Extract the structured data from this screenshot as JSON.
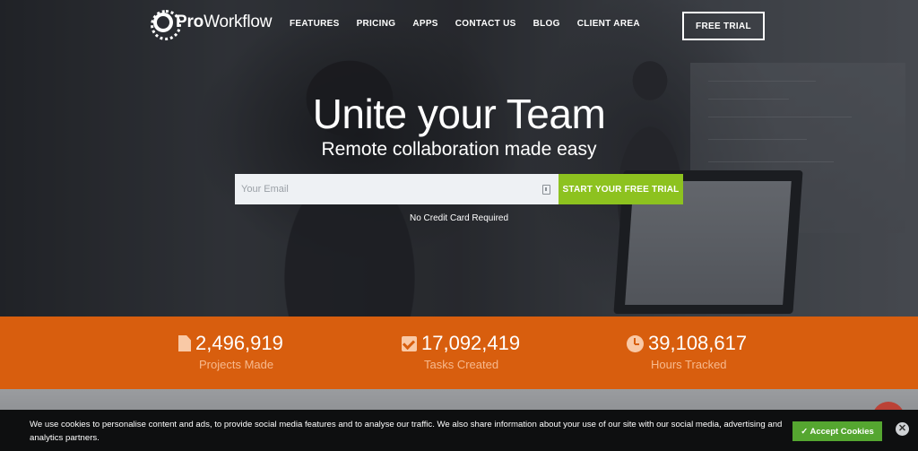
{
  "nav": {
    "logo_bold": "Pro",
    "logo_rest": "Workflow",
    "links": [
      "FEATURES",
      "PRICING",
      "APPS",
      "CONTACT US",
      "BLOG",
      "CLIENT AREA"
    ],
    "cta": "FREE TRIAL"
  },
  "hero": {
    "headline": "Unite your Team",
    "subheadline": "Remote collaboration made easy",
    "email_placeholder": "Your Email",
    "start_button": "START YOUR FREE TRIAL",
    "note": "No Credit Card Required"
  },
  "stats": [
    {
      "icon": "document-icon",
      "value": "2,496,919",
      "label": "Projects Made"
    },
    {
      "icon": "checkbox-icon",
      "value": "17,092,419",
      "label": "Tasks Created"
    },
    {
      "icon": "clock-icon",
      "value": "39,108,617",
      "label": "Hours Tracked"
    }
  ],
  "cookie": {
    "text": "We use cookies to personalise content and ads, to provide social media features and to analyse our traffic. We also share information about your use of our site with our social media, advertising and analytics partners.",
    "accept": "✓ Accept Cookies",
    "close": "✕"
  },
  "colors": {
    "accent_green": "#8dc21f",
    "stats_orange": "#d85e0e",
    "cookie_green": "#55a630"
  }
}
